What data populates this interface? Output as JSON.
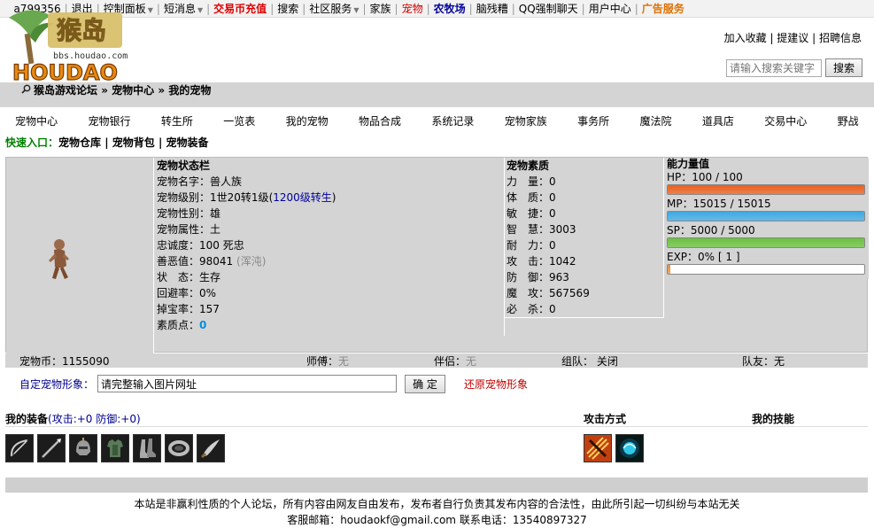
{
  "topbar": {
    "user": "a799356",
    "items": [
      "退出",
      "控制面板",
      "短消息",
      "交易币充值",
      "搜索",
      "社区服务",
      "家族",
      "宠物",
      "农牧场",
      "脑残糟",
      "QQ强制聊天",
      "用户中心",
      "广告服务"
    ]
  },
  "logo": {
    "cn": "猴岛",
    "url_text": "bbs.houdao.com",
    "en": "HOUDAO"
  },
  "header": {
    "links": [
      "加入收藏",
      "提建议",
      "招聘信息"
    ],
    "search_placeholder": "请输入搜索关键字",
    "search_button": "搜索"
  },
  "breadcrumb": {
    "home": "猴岛游戏论坛",
    "section": "宠物中心",
    "page": "我的宠物",
    "separator": "»"
  },
  "nav": [
    "宠物中心",
    "宠物银行",
    "转生所",
    "一览表",
    "我的宠物",
    "物品合成",
    "系统记录",
    "宠物家族",
    "事务所",
    "魔法院",
    "道具店",
    "交易中心",
    "野战"
  ],
  "quick": {
    "label": "快速入口：",
    "links": [
      "宠物仓库",
      "宠物背包",
      "宠物装备"
    ]
  },
  "status": {
    "title": "宠物状态栏",
    "name_label": "宠物名字：",
    "name": "兽人族",
    "level_label": "宠物级别：",
    "level": "1世20转1级",
    "level_link": "1200级转生",
    "gender_label": "宠物性别：",
    "gender": "雄",
    "attr_label": "宠物属性：",
    "attr": "土",
    "loyalty_label": "忠诚度：",
    "loyalty": "100 死忠",
    "karma_label": "善恶值：",
    "karma": "98041",
    "karma_note": "(浑沌)",
    "state_label": "状　态：",
    "state": "生存",
    "dodge_label": "回避率：",
    "dodge": "0%",
    "drop_label": "掉宝率：",
    "drop": "157",
    "points_label": "素质点：",
    "points": "0"
  },
  "quality": {
    "title": "宠物素质",
    "rows": [
      {
        "label": "力　量：",
        "value": "0"
      },
      {
        "label": "体　质：",
        "value": "0"
      },
      {
        "label": "敏　捷：",
        "value": "0"
      },
      {
        "label": "智　慧：",
        "value": "3003"
      },
      {
        "label": "耐　力：",
        "value": "0"
      },
      {
        "label": "攻　击：",
        "value": "1042"
      },
      {
        "label": "防　御：",
        "value": "963"
      },
      {
        "label": "魔　攻：",
        "value": "567569"
      },
      {
        "label": "必　杀：",
        "value": "0"
      }
    ]
  },
  "ability": {
    "title": "能力量值",
    "hp": {
      "label": "HP：",
      "text": "100 / 100",
      "fraction": 1.0,
      "color": "#e86020"
    },
    "mp": {
      "label": "MP：",
      "text": "15015 / 15015",
      "fraction": 1.0,
      "color": "#40a8e0"
    },
    "sp": {
      "label": "SP：",
      "text": "5000 / 5000",
      "fraction": 1.0,
      "color": "#6cc040"
    },
    "exp": {
      "label": "EXP：",
      "text": "0%  [ 1 ]",
      "fraction": 0.0,
      "color": "#e89040"
    }
  },
  "info": {
    "coin_label": "宠物币：",
    "coin": "1155090",
    "master_label": "师傅：",
    "master": "无",
    "partner_label": "伴侣：",
    "partner": "无",
    "team_label": "组队：",
    "team": "关闭",
    "mate_label": "队友：",
    "mate": "无"
  },
  "custom": {
    "label": "自定宠物形象：",
    "input_value": "请完整输入图片网址",
    "confirm": "确 定",
    "restore": "还原宠物形象"
  },
  "equip": {
    "title": "我的装备",
    "stats": "(攻击:+0 防御:+0)",
    "attack_title": "攻击方式",
    "skill_title": "我的技能",
    "items": [
      "bow-icon",
      "spear-icon",
      "helmet-icon",
      "armor-icon",
      "boots-icon",
      "bracelet-icon",
      "blade-icon"
    ],
    "attacks": [
      "fire-claw-icon",
      "cyan-orb-icon"
    ]
  },
  "footer": {
    "line1": "本站是非赢利性质的个人论坛，所有内容由网友自由发布，发布者自行负责其发布内容的合法性，由此所引起一切纠纷与本站无关",
    "line2": "客服邮箱：houdaokf@gmail.com 联系电话：13540897327"
  }
}
